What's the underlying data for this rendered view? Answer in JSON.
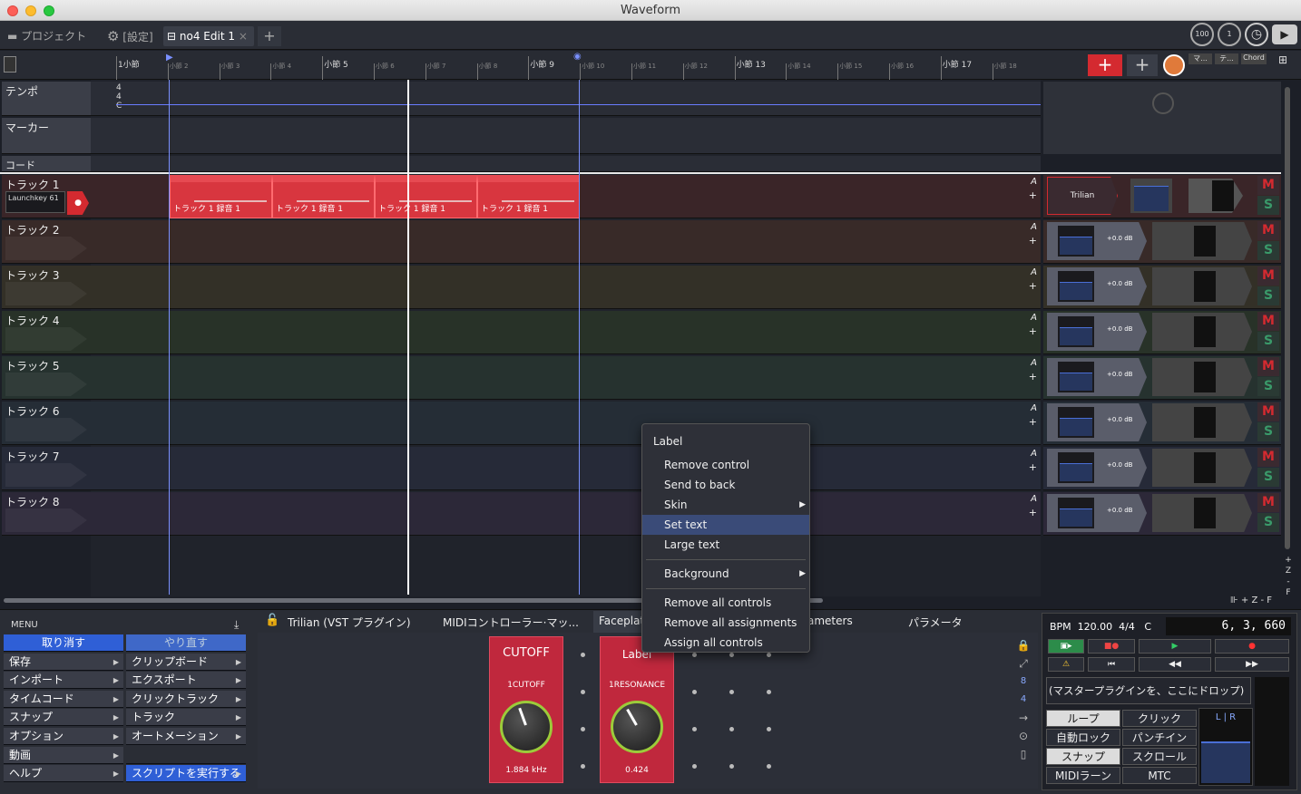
{
  "window": {
    "title": "Waveform"
  },
  "tabs": {
    "project": "プロジェクト",
    "settings": "[設定]",
    "edit": "no4 Edit 1",
    "close": "×",
    "add": "+"
  },
  "topright": {
    "tempo_knob": "100",
    "knob2": "1"
  },
  "ruler": {
    "bars": [
      {
        "label": "1小節",
        "big": true
      },
      {
        "label": "小節 2",
        "big": false
      },
      {
        "label": "小節 3",
        "big": false
      },
      {
        "label": "小節 4",
        "big": false
      },
      {
        "label": "小節 5",
        "big": true
      },
      {
        "label": "小節 6",
        "big": false
      },
      {
        "label": "小節 7",
        "big": false
      },
      {
        "label": "小節 8",
        "big": false
      },
      {
        "label": "小節 9",
        "big": true
      },
      {
        "label": "小節 10",
        "big": false
      },
      {
        "label": "小節 11",
        "big": false
      },
      {
        "label": "小節 12",
        "big": false
      },
      {
        "label": "小節 13",
        "big": true
      },
      {
        "label": "小節 14",
        "big": false
      },
      {
        "label": "小節 15",
        "big": false
      },
      {
        "label": "小節 16",
        "big": false
      },
      {
        "label": "小節 17",
        "big": true
      },
      {
        "label": "小節 18",
        "big": false
      }
    ],
    "buttons": {
      "add": "+",
      "plus": "+",
      "m": "マ...",
      "te": "テ...",
      "chord": "Chord"
    }
  },
  "global_tracks": {
    "tempo": "テンポ",
    "marker": "マーカー",
    "chord": "コード",
    "time_sig_top": "4",
    "time_sig_bottom": "4",
    "key": "C"
  },
  "tracks": [
    {
      "name": "トラック 1",
      "color": "#3a2528",
      "plugin": "Trilian",
      "input": "Launchkey 61"
    },
    {
      "name": "トラック 2",
      "color": "#382a28",
      "gain": "+0.0 dB"
    },
    {
      "name": "トラック 3",
      "color": "#333027",
      "gain": "+0.0 dB"
    },
    {
      "name": "トラック 4",
      "color": "#283228",
      "gain": "+0.0 dB"
    },
    {
      "name": "トラック 5",
      "color": "#26322f",
      "gain": "+0.0 dB"
    },
    {
      "name": "トラック 6",
      "color": "#252d36",
      "gain": "+0.0 dB"
    },
    {
      "name": "トラック 7",
      "color": "#262a38",
      "gain": "+0.0 dB"
    },
    {
      "name": "トラック 8",
      "color": "#2c2838",
      "gain": "+0.0 dB"
    }
  ],
  "track_letters": {
    "a": "A",
    "plus": "+",
    "m": "M",
    "s": "S"
  },
  "clips": [
    "トラック 1 録音 1",
    "トラック 1 録音 1",
    "トラック 1 録音 1",
    "トラック 1 録音 1"
  ],
  "context_menu": {
    "header": "Label",
    "items": [
      "Remove control",
      "Send to back",
      "Skin",
      "Set text",
      "Large text",
      "Background",
      "Remove all controls",
      "Remove all assignments",
      "Assign all controls"
    ]
  },
  "zoom": {
    "label": "+ Z - F"
  },
  "menu": {
    "title": "MENU",
    "left": [
      "取り消す",
      "保存",
      "インポート",
      "タイムコード",
      "スナップ",
      "オプション",
      "動画",
      "ヘルプ"
    ],
    "right": [
      "やり直す",
      "クリップボード",
      "エクスポート",
      "クリックトラック",
      "トラック",
      "オートメーション",
      "",
      "スクリプトを実行する"
    ]
  },
  "plugin_tabs": [
    "Trilian (VST プラグイン)",
    "MIDIコントローラー·マッ...",
    "Faceplat",
    "ameters",
    "パラメータ"
  ],
  "knobs": [
    {
      "title": "CUTOFF",
      "label": "1CUTOFF",
      "value": "1.884 kHz"
    },
    {
      "title": "Label",
      "label": "1RESONANCE",
      "value": "0.424"
    }
  ],
  "side_numbers": [
    "8",
    "4"
  ],
  "transport": {
    "bpm_label": "BPM",
    "bpm": "120.00",
    "sig": "4/4",
    "key": "C",
    "position": "6, 3, 660",
    "drop": "(マスタープラグインを、ここにドロップ)",
    "buttons": [
      "ループ",
      "クリック",
      "自動ロック",
      "パンチイン",
      "スナップ",
      "スクロール",
      "MIDIラーン",
      "MTC"
    ],
    "lr": "L | R"
  }
}
